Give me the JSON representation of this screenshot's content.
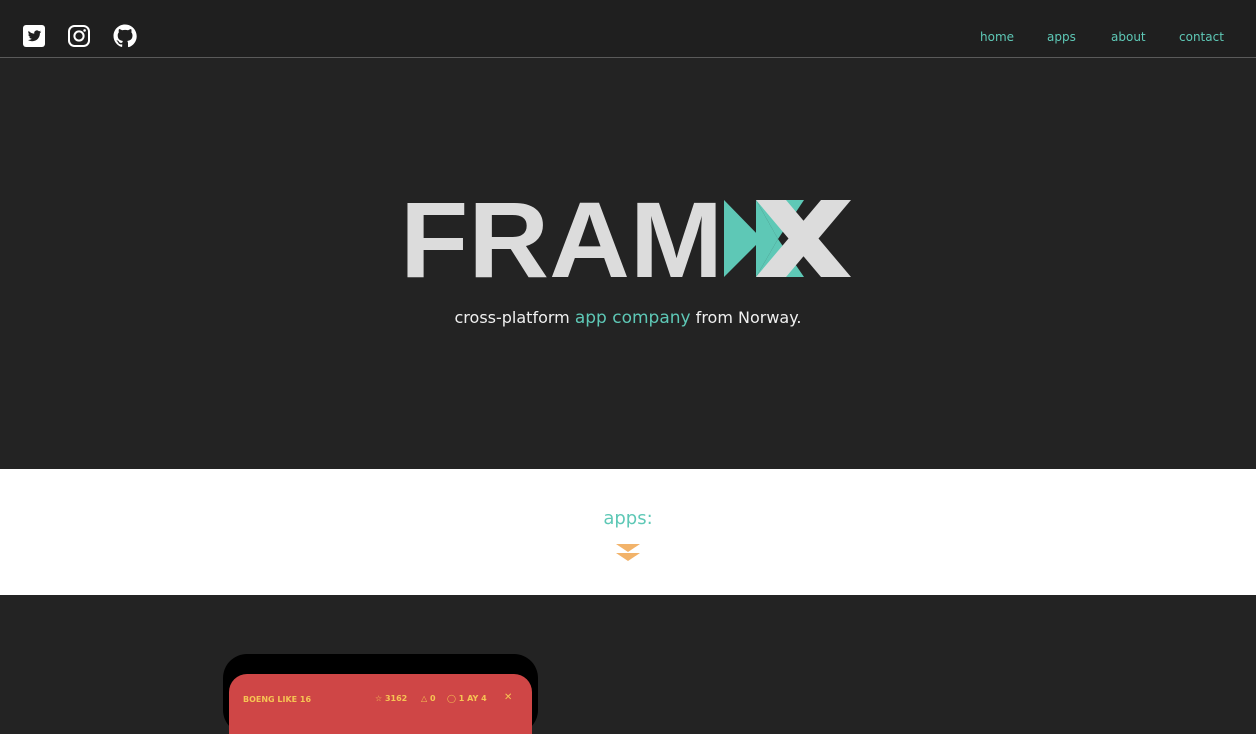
{
  "header": {
    "social": [
      {
        "icon": "twitter-icon"
      },
      {
        "icon": "instagram-icon"
      },
      {
        "icon": "github-icon"
      }
    ],
    "nav": {
      "home": "home",
      "apps": "apps",
      "about": "about",
      "contact": "contact"
    }
  },
  "hero": {
    "logo_text": "FRAMX",
    "tagline": {
      "before": "cross-platform ",
      "accent": "app company",
      "after": " from Norway."
    }
  },
  "apps_section": {
    "heading": "apps:",
    "scroll_icon": "double-chevron-down-icon"
  },
  "app_preview": {
    "title": "BOENG LIKE 16",
    "stats": [
      "3162",
      "0",
      "1 AY 4"
    ]
  },
  "colors": {
    "background": "#232323",
    "header_bg": "#1f1f1f",
    "accent": "#5ec8b6",
    "logo_gray": "#dcdcdc",
    "chevron": "#f2b36a",
    "app_red": "#cf4646",
    "app_yellow": "#f6c453"
  }
}
